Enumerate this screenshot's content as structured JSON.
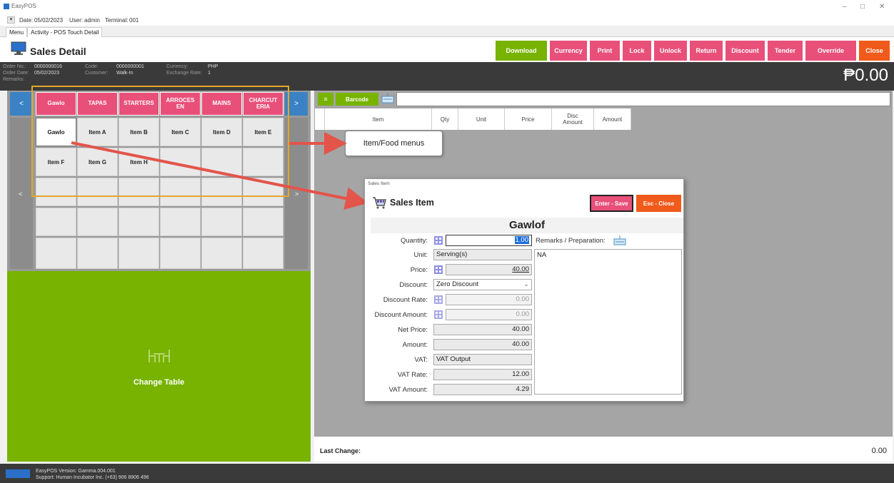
{
  "window": {
    "app_title": "EasyPOS",
    "info": {
      "date_label": "Date:",
      "date": "05/02/2023",
      "user_label": "User:",
      "user": "admin",
      "terminal_label": "Terminal:",
      "terminal": "001"
    },
    "tabs": [
      "Menu",
      "Activity - POS Touch Detail"
    ],
    "minimize": "–",
    "maximize": "□",
    "close": "✕"
  },
  "header": {
    "title": "Sales Detail",
    "buttons": {
      "download": "Download",
      "currency": "Currency",
      "print": "Print",
      "lock": "Lock",
      "unlock": "Unlock",
      "return": "Return",
      "discount": "Discount",
      "tender": "Tender",
      "override": "Override",
      "close": "Close"
    },
    "colors": {
      "green": "#77b300",
      "pink": "#e8507a",
      "orange": "#f05a1a"
    }
  },
  "order_info": {
    "order_no_label": "Order No.:",
    "order_no": "0000000016",
    "order_date_label": "Order Date:",
    "order_date": "05/02/2023",
    "remarks_label": "Remarks:",
    "code_label": "Code:",
    "code": "0000000001",
    "customer_label": "Customer:",
    "customer": "Walk-In",
    "currency_label": "Currency:",
    "currency": "PHP",
    "exchange_label": "Exchange Rate:",
    "exchange_rate": "1",
    "total": "₱0.00"
  },
  "categories": {
    "prev": "<",
    "next": ">",
    "items": [
      "Gawlo",
      "TAPAS",
      "STARTERS",
      "ARROCES\nEN",
      "MAINS",
      "CHARCUT\nERIA"
    ]
  },
  "items": {
    "prev": "<",
    "next": ">",
    "row1": [
      "Gawlo",
      "Item A",
      "Item B",
      "Item C",
      "Item D",
      "Item E"
    ],
    "row2": [
      "Item F",
      "Item G",
      "Item H"
    ]
  },
  "change_table": "Change Table",
  "barcode": {
    "menu_icon": "≡",
    "label": "Barcode",
    "value": ""
  },
  "grid": {
    "columns": [
      "Item",
      "Qty",
      "Unit",
      "Price",
      "Disc\nAmount",
      "Amount"
    ]
  },
  "annotation": {
    "callout": "Item/Food menus"
  },
  "last_change": {
    "label": "Last Change:",
    "value": "0.00"
  },
  "footer": {
    "version": "EasyPOS Version: Gamma.004.001",
    "support": "Support: Human Incubator Inc. (+63) 906 8906 496"
  },
  "dialog": {
    "window_title": "Sales Item",
    "title": "Sales Item",
    "save_button": "Enter - Save",
    "close_button": "Esc - Close",
    "item_name": "Gawlof",
    "quantity_label": "Quantity:",
    "quantity": "1.00",
    "remarks_label": "Remarks / Preparation:",
    "remarks": "NA",
    "unit_label": "Unit:",
    "unit": "Serving(s)",
    "price_label": "Price:",
    "price": "40.00",
    "discount_label": "Discount:",
    "discount": "Zero Discount",
    "discount_rate_label": "Discount Rate:",
    "discount_rate": "0.00",
    "discount_amount_label": "Discount Amount:",
    "discount_amount": "0.00",
    "net_price_label": "Net Price:",
    "net_price": "40.00",
    "amount_label": "Amount:",
    "amount": "40.00",
    "vat_label": "VAT:",
    "vat": "VAT Output",
    "vat_rate_label": "VAT Rate:",
    "vat_rate": "12.00",
    "vat_amount_label": "VAT Amount:",
    "vat_amount": "4.29"
  }
}
